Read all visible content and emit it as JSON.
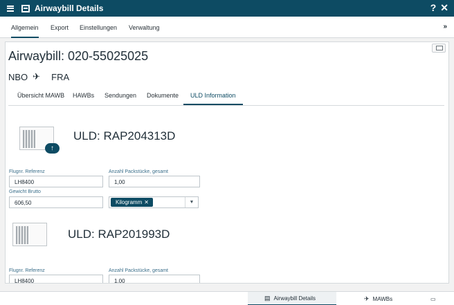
{
  "header": {
    "title": "Airwaybill Details",
    "help": "?",
    "close": "✕"
  },
  "top_tabs": [
    "Allgemein",
    "Export",
    "Einstellungen",
    "Verwaltung"
  ],
  "awb": {
    "title": "Airwaybill: 020-55025025",
    "origin": "NBO",
    "destination": "FRA"
  },
  "sub_tabs": [
    "Übersicht MAWB",
    "HAWBs",
    "Sendungen",
    "Dokumente",
    "ULD Information"
  ],
  "ulds": [
    {
      "title": "ULD: RAP204313D",
      "flight_label": "Flugnr. Referenz",
      "flight_value": "LH8400",
      "pieces_label": "Anzahl Packstücke, gesamt",
      "pieces_value": "1,00",
      "weight_label": "Gewicht Brutto",
      "weight_value": "606,50",
      "unit_value": "Kilogramm"
    },
    {
      "title": "ULD: RAP201993D",
      "flight_label": "Flugnr. Referenz",
      "flight_value": "LH8400",
      "pieces_label": "Anzahl Packstücke, gesamt",
      "pieces_value": "1,00"
    }
  ],
  "bottom_tabs": [
    "Airwaybill Details",
    "MAWBs"
  ],
  "icons": {
    "menu": "menu-icon",
    "plane": "plane-icon",
    "upload": "cloud-upload-icon",
    "monitor": "monitor-icon"
  },
  "colors": {
    "brand": "#0d4b63"
  }
}
